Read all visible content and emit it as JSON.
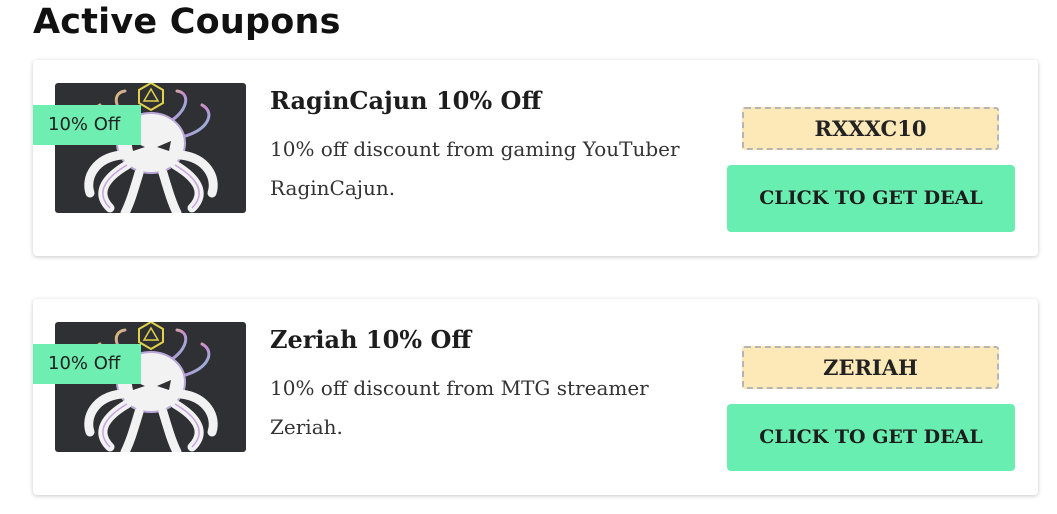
{
  "section": {
    "heading": "Active Coupons"
  },
  "coupons": [
    {
      "badge": "10% Off",
      "title": "RaginCajun 10% Off",
      "description": "10% off discount from gaming YouTuber RaginCajun.",
      "code": "RXXXC10",
      "button_label": "CLICK TO GET DEAL"
    },
    {
      "badge": "10% Off",
      "title": "Zeriah 10% Off",
      "description": "10% off discount from MTG streamer Zeriah.",
      "code": "ZERIAH",
      "button_label": "CLICK TO GET DEAL"
    }
  ],
  "colors": {
    "accent_green": "#68eeb0",
    "code_background": "#fde9b7",
    "thumbnail_background": "#2f3033"
  },
  "icons": {
    "thumbnail": "octopus-d20-logo-icon"
  }
}
